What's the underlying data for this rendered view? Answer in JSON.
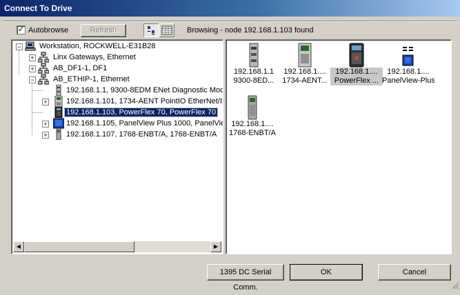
{
  "window": {
    "title": "Connect To Drive"
  },
  "toolbar": {
    "autobrowse_checked": true,
    "autobrowse_label": "Autobrowse",
    "refresh_label": "Refresh",
    "status": "Browsing - node 192.168.1.103 found"
  },
  "tree": {
    "workstation": "Workstation, ROCKWELL-E31B28",
    "linx": "Linx Gateways, Ethernet",
    "df1": "AB_DF1-1, DF1",
    "ethip": "AB_ETHIP-1, Ethernet",
    "nodes": [
      "192.168.1.1, 9300-8EDM ENet Diagnostic Modu",
      "192.168.1.101, 1734-AENT PointIO EtherNet/I",
      "192.168.1.103, PowerFlex 70, PowerFlex 70",
      "192.168.1.105, PanelView Plus 1000, PanelView",
      "192.168.1.107, 1768-ENBT/A, 1768-ENBT/A"
    ]
  },
  "devices": [
    {
      "ip": "192.168.1.1",
      "name": "9300-8ED..."
    },
    {
      "ip": "192.168.1....",
      "name": "1734-AENT..."
    },
    {
      "ip": "192.168.1....",
      "name": "PowerFlex ..."
    },
    {
      "ip": "192.168.1....",
      "name": "PanelView-Plus"
    },
    {
      "ip": "192.168.1....",
      "name": "1768-ENBT/A"
    }
  ],
  "buttons": {
    "serial": "1395 DC Serial Comm.",
    "ok": "OK",
    "cancel": "Cancel"
  }
}
